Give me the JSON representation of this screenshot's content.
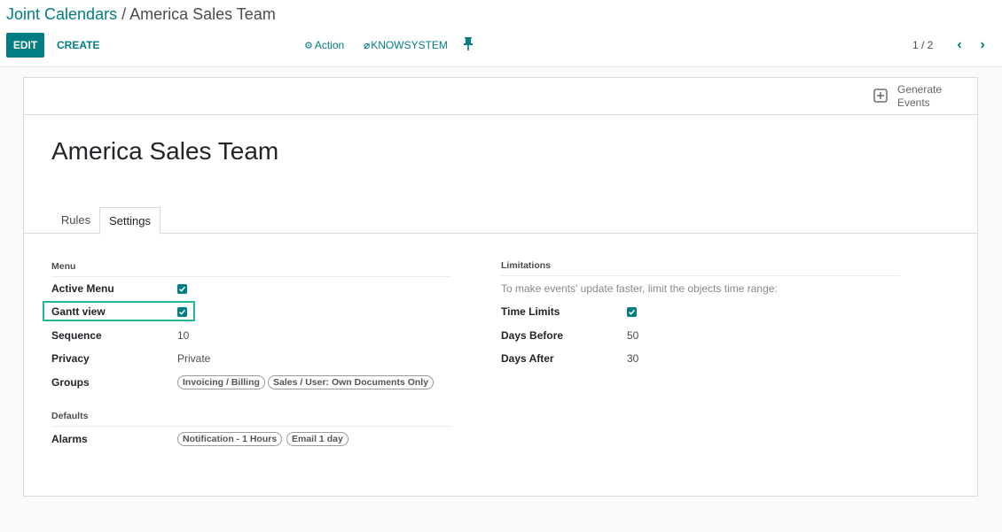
{
  "breadcrumb": {
    "parent": "Joint Calendars",
    "separator": " / ",
    "current": "America Sales Team"
  },
  "toolbar": {
    "edit_label": "EDIT",
    "create_label": "CREATE",
    "action_label": "Action",
    "knowsystem_label": "KNOWSYSTEM",
    "pager": "1 / 2"
  },
  "button_box": {
    "generate_line1": "Generate",
    "generate_line2": "Events"
  },
  "record": {
    "title": "America Sales Team"
  },
  "tabs": [
    {
      "label": "Rules"
    },
    {
      "label": "Settings"
    }
  ],
  "menu_group": {
    "heading": "Menu",
    "active_menu_label": "Active Menu",
    "active_menu_checked": true,
    "gantt_view_label": "Gantt view",
    "gantt_view_checked": true,
    "sequence_label": "Sequence",
    "sequence_value": "10",
    "privacy_label": "Privacy",
    "privacy_value": "Private",
    "groups_label": "Groups",
    "groups_tags": [
      "Invoicing / Billing",
      "Sales / User: Own Documents Only"
    ]
  },
  "defaults_group": {
    "heading": "Defaults",
    "alarms_label": "Alarms",
    "alarms_tags": [
      "Notification - 1 Hours",
      "Email 1 day"
    ]
  },
  "limitations_group": {
    "heading": "Limitations",
    "help_text": "To make events' update faster, limit the objects time range:",
    "time_limits_label": "Time Limits",
    "time_limits_checked": true,
    "days_before_label": "Days Before",
    "days_before_value": "50",
    "days_after_label": "Days After",
    "days_after_value": "30"
  },
  "colors": {
    "accent": "#017e84",
    "highlight": "#21b799"
  },
  "icons": {
    "action": "gear-icon",
    "knowsystem": "knowsystem-icon",
    "pin": "pin-icon",
    "generate": "plus-square-icon",
    "prev": "chevron-left-icon",
    "next": "chevron-right-icon"
  }
}
